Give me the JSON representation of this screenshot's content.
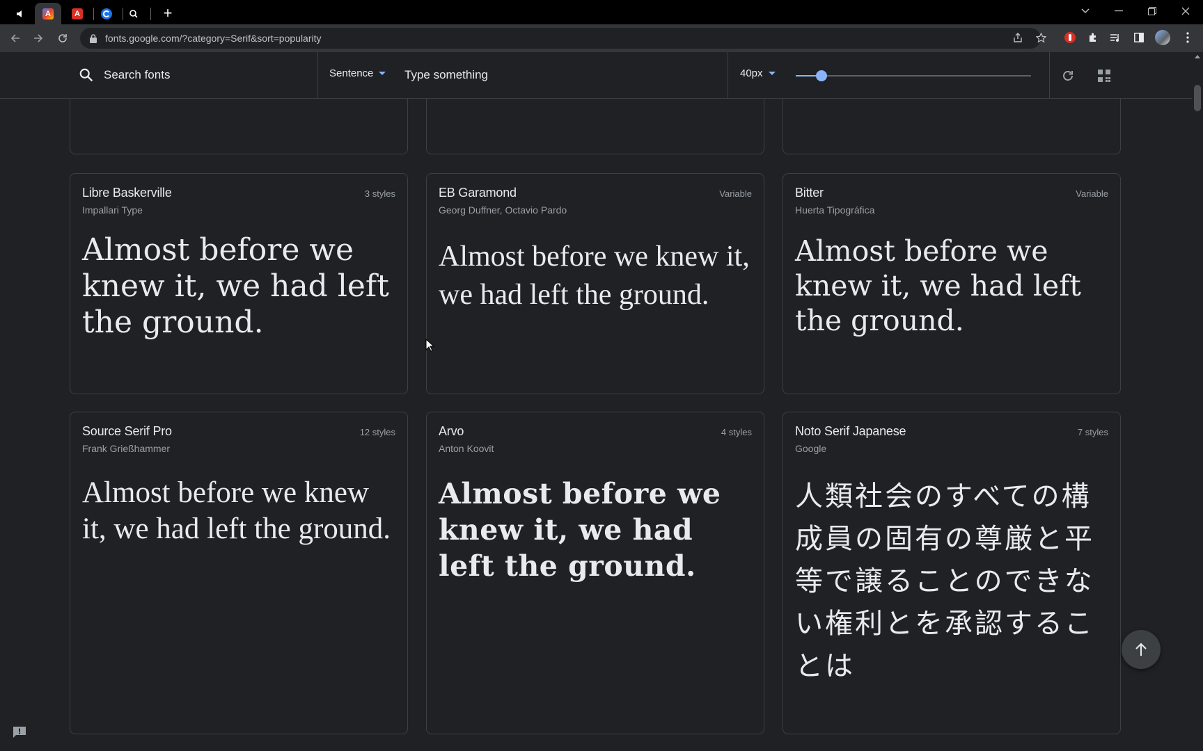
{
  "browser": {
    "tabs": [
      {
        "icon": "speaker-icon",
        "active": false
      },
      {
        "icon": "fonts-favicon",
        "active": true
      },
      {
        "icon": "acrobat-favicon",
        "active": false
      },
      {
        "icon": "circle-c-favicon",
        "active": false
      },
      {
        "icon": "search-favicon",
        "active": false
      }
    ],
    "url": "fonts.google.com/?category=Serif&sort=popularity"
  },
  "filterbar": {
    "search_placeholder": "Search fonts",
    "preview_mode": "Sentence",
    "type_placeholder": "Type something",
    "font_size": "40px",
    "font_size_fraction": 0.11
  },
  "cards": [
    {
      "name": "Libre Baskerville",
      "author": "Impallari Type",
      "styles": "3 styles",
      "sample": "Almost before we knew it, we had left the ground."
    },
    {
      "name": "EB Garamond",
      "author": "Georg Duffner, Octavio Pardo",
      "styles": "Variable",
      "sample": "Almost before we knew it, we had left the ground."
    },
    {
      "name": "Bitter",
      "author": "Huerta Tipográfica",
      "styles": "Variable",
      "sample": "Almost before we knew it, we had left the ground."
    },
    {
      "name": "Source Serif Pro",
      "author": "Frank Grießhammer",
      "styles": "12 styles",
      "sample": "Almost before we knew it, we had left the ground."
    },
    {
      "name": "Arvo",
      "author": "Anton Koovit",
      "styles": "4 styles",
      "sample": "Almost before we knew it, we had left the ground."
    },
    {
      "name": "Noto Serif Japanese",
      "author": "Google",
      "styles": "7 styles",
      "sample": "人類社会のすべての構成員の固有の尊厳と平等で譲ることのできない権利とを承認することは"
    }
  ],
  "colors": {
    "background": "#202124",
    "accent": "#8ab4f8",
    "card_border": "#3c4043",
    "muted_text": "#9aa0a6"
  }
}
